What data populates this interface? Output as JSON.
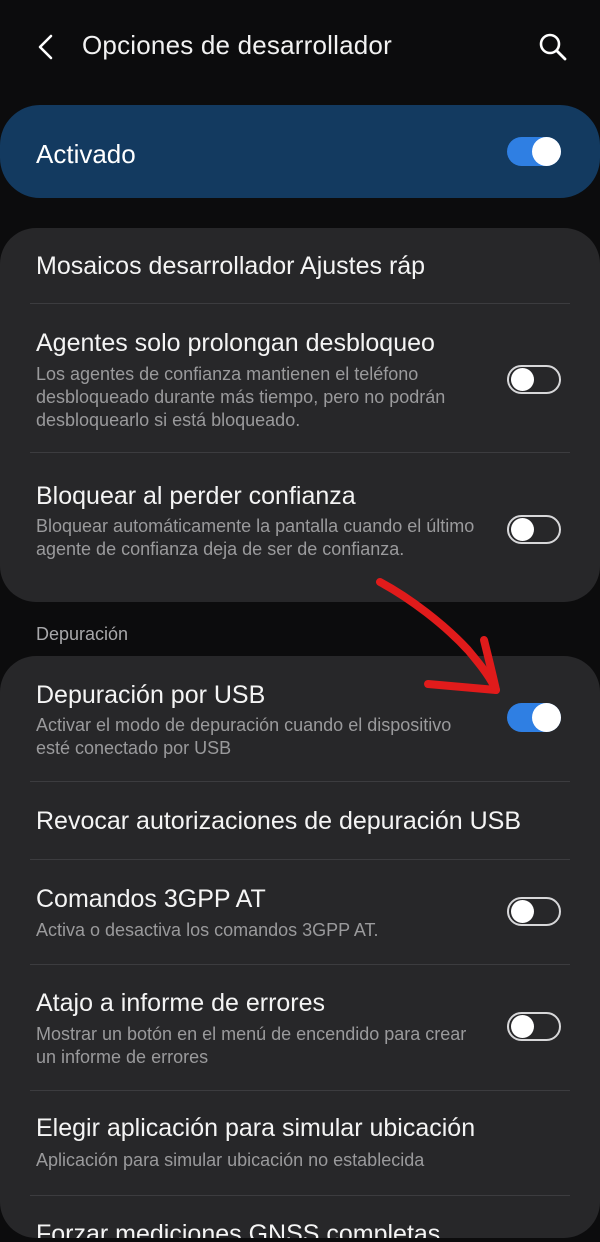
{
  "header": {
    "title": "Opciones de desarrollador"
  },
  "master_switch": {
    "label": "Activado",
    "state": "on",
    "accent_color": "#2f7fe3",
    "background_color": "#133a60"
  },
  "group1": {
    "items": [
      {
        "title": "Mosaicos desarrollador Ajustes ráp"
      },
      {
        "title": "Agentes solo prolongan desbloqueo",
        "description": "Los agentes de confianza mantienen el teléfono desbloqueado durante más tiempo, pero no podrán desbloquearlo si está bloqueado.",
        "toggle": "off"
      },
      {
        "title": "Bloquear al perder confianza",
        "description": "Bloquear automáticamente la pantalla cuando el último agente de confianza deja de ser de confianza.",
        "toggle": "off"
      }
    ]
  },
  "section_debug": {
    "header": "Depuración",
    "items": [
      {
        "title": "Depuración por USB",
        "description": "Activar el modo de depuración cuando el dispositivo esté conectado por USB",
        "toggle": "on"
      },
      {
        "title": "Revocar autorizaciones de depuración USB"
      },
      {
        "title": "Comandos 3GPP AT",
        "description": "Activa o desactiva los comandos 3GPP AT.",
        "toggle": "off"
      },
      {
        "title": "Atajo a informe de errores",
        "description": "Mostrar un botón en el menú de encendido para crear un informe de errores",
        "toggle": "off"
      },
      {
        "title": "Elegir aplicación para simular ubicación",
        "description": "Aplicación para simular ubicación no establecida"
      },
      {
        "title": "Forzar mediciones GNSS completas"
      }
    ]
  },
  "annotation": {
    "arrow_color": "#e01b1b"
  }
}
